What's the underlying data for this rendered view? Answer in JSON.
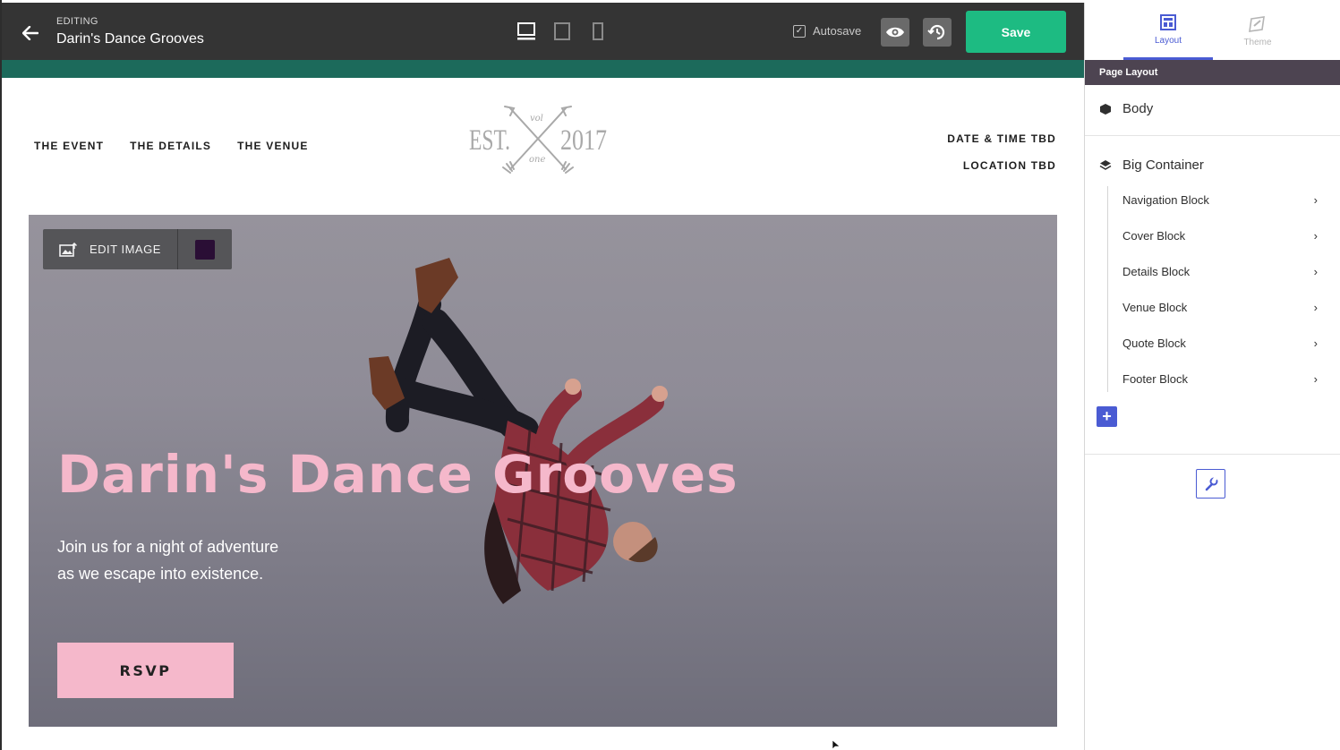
{
  "editor": {
    "editing_label": "EDITING",
    "doc_title": "Darin's Dance Grooves",
    "autosave_label": "Autosave",
    "save_label": "Save"
  },
  "site": {
    "nav": [
      "THE EVENT",
      "THE DETAILS",
      "THE VENUE"
    ],
    "date_time": "DATE & TIME TBD",
    "location": "LOCATION TBD",
    "logo": {
      "est": "EST.",
      "year": "2017",
      "top_script": "vol",
      "bottom_script": "one"
    }
  },
  "cover": {
    "edit_image_label": "EDIT IMAGE",
    "title": "Darin's Dance Grooves",
    "subtitle_line1": "Join us for a night of adventure",
    "subtitle_line2": "as we escape into existence.",
    "rsvp_label": "RSVP",
    "swatch_color": "#2a0e35",
    "title_color": "#f5b8cb"
  },
  "panel": {
    "tabs": [
      {
        "label": "Layout",
        "icon": "layout-icon",
        "active": true
      },
      {
        "label": "Theme",
        "icon": "theme-icon",
        "active": false
      }
    ],
    "section_title": "Page Layout",
    "body_label": "Body",
    "container_label": "Big Container",
    "blocks": [
      "Navigation Block",
      "Cover Block",
      "Details Block",
      "Venue Block",
      "Quote Block",
      "Footer Block"
    ]
  },
  "colors": {
    "topbar": "#343434",
    "save": "#1dbb82",
    "accent": "#4a5bd3",
    "teal_strip": "#1c6a5b"
  }
}
